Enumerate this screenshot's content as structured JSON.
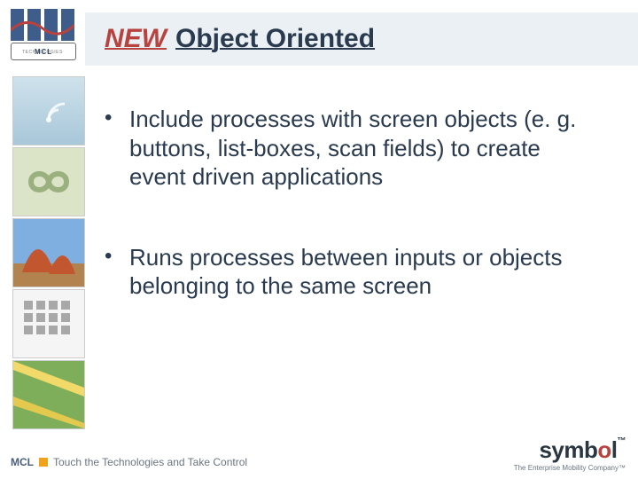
{
  "title": {
    "new_word": "NEW",
    "rest": "Object Oriented"
  },
  "bullets": [
    "Include processes with screen objects (e. g. buttons, list-boxes, scan fields) to create event driven applications",
    "Runs processes between inputs or objects belonging to the same screen"
  ],
  "logo": {
    "text": "MCL",
    "subtext": "TECHNOLOGIES"
  },
  "footer": {
    "mcl": "MCL",
    "tagline": "Touch the Technologies and Take Control",
    "symbol_name_pre": "symb",
    "symbol_o": "o",
    "symbol_name_post": "l",
    "symbol_tagline": "The Enterprise Mobility Company™"
  }
}
